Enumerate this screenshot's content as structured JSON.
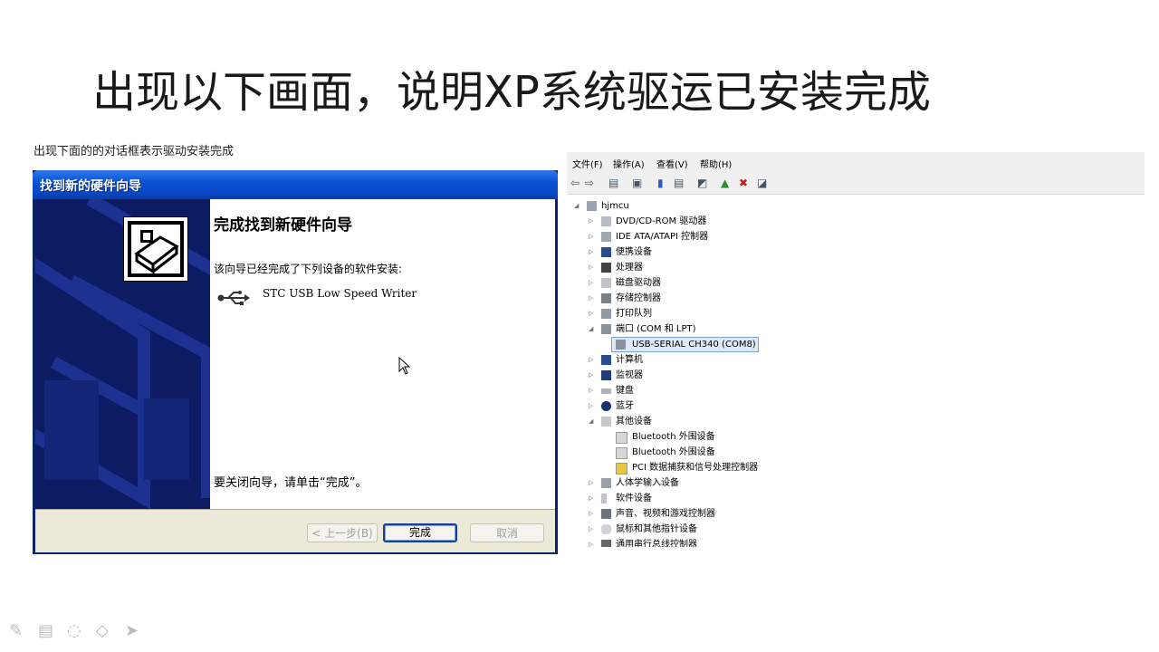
{
  "slide": {
    "title": "出现以下画面，说明XP系统驱运已安装完成",
    "caption": "出现下面的的对话框表示驱动安装完成"
  },
  "wizard": {
    "title": "找到新的硬件向导",
    "heading": "完成找到新硬件向导",
    "message": "该向导已经完成了下列设备的软件安装:",
    "device": "STC USB Low Speed Writer",
    "closing": "要关闭向导，请单击“完成”。",
    "buttons": {
      "back": "< 上一步(B)",
      "finish": "完成",
      "cancel": "取消"
    }
  },
  "device_manager": {
    "menu": [
      "文件(F)",
      "操作(A)",
      "查看(V)",
      "帮助(H)"
    ],
    "tree": [
      {
        "label": "hjmcu",
        "level": 0,
        "expanded": true,
        "icon": "computer-icon"
      },
      {
        "label": "DVD/CD-ROM 驱动器",
        "level": 1,
        "expanded": false,
        "icon": "dvd-icon"
      },
      {
        "label": "IDE ATA/ATAPI 控制器",
        "level": 1,
        "expanded": false,
        "icon": "ide-icon"
      },
      {
        "label": "便携设备",
        "level": 1,
        "expanded": false,
        "icon": "portable-device-icon"
      },
      {
        "label": "处理器",
        "level": 1,
        "expanded": false,
        "icon": "processor-icon"
      },
      {
        "label": "磁盘驱动器",
        "level": 1,
        "expanded": false,
        "icon": "disk-icon"
      },
      {
        "label": "存储控制器",
        "level": 1,
        "expanded": false,
        "icon": "storage-controller-icon"
      },
      {
        "label": "打印队列",
        "level": 1,
        "expanded": false,
        "icon": "printer-icon"
      },
      {
        "label": "端口 (COM 和 LPT)",
        "level": 1,
        "expanded": true,
        "icon": "port-icon"
      },
      {
        "label": "USB-SERIAL CH340 (COM8)",
        "level": 2,
        "selected": true,
        "icon": "port-icon"
      },
      {
        "label": "计算机",
        "level": 1,
        "expanded": false,
        "icon": "computer-icon"
      },
      {
        "label": "监视器",
        "level": 1,
        "expanded": false,
        "icon": "monitor-icon"
      },
      {
        "label": "键盘",
        "level": 1,
        "expanded": false,
        "icon": "keyboard-icon"
      },
      {
        "label": "蓝牙",
        "level": 1,
        "expanded": false,
        "icon": "bluetooth-icon"
      },
      {
        "label": "其他设备",
        "level": 1,
        "expanded": true,
        "icon": "unknown-device-icon"
      },
      {
        "label": "Bluetooth 外围设备",
        "level": 2,
        "icon": "warning-device-icon"
      },
      {
        "label": "Bluetooth 外围设备",
        "level": 2,
        "icon": "warning-device-icon"
      },
      {
        "label": "PCI 数据捕获和信号处理控制器",
        "level": 2,
        "icon": "warning-device-icon"
      },
      {
        "label": "人体学输入设备",
        "level": 1,
        "expanded": false,
        "icon": "hid-icon"
      },
      {
        "label": "软件设备",
        "level": 1,
        "expanded": false,
        "icon": "software-device-icon"
      },
      {
        "label": "声音、视频和游戏控制器",
        "level": 1,
        "expanded": false,
        "icon": "sound-icon"
      },
      {
        "label": "鼠标和其他指针设备",
        "level": 1,
        "expanded": false,
        "icon": "mouse-icon"
      },
      {
        "label": "通用串行总线控制器",
        "level": 1,
        "expanded": false,
        "icon": "usb-icon"
      }
    ]
  },
  "colors": {
    "xp_titlebar": "#0a52d4",
    "wizard_sidebar": "#0d1b63",
    "selection": "#dde9f7"
  }
}
